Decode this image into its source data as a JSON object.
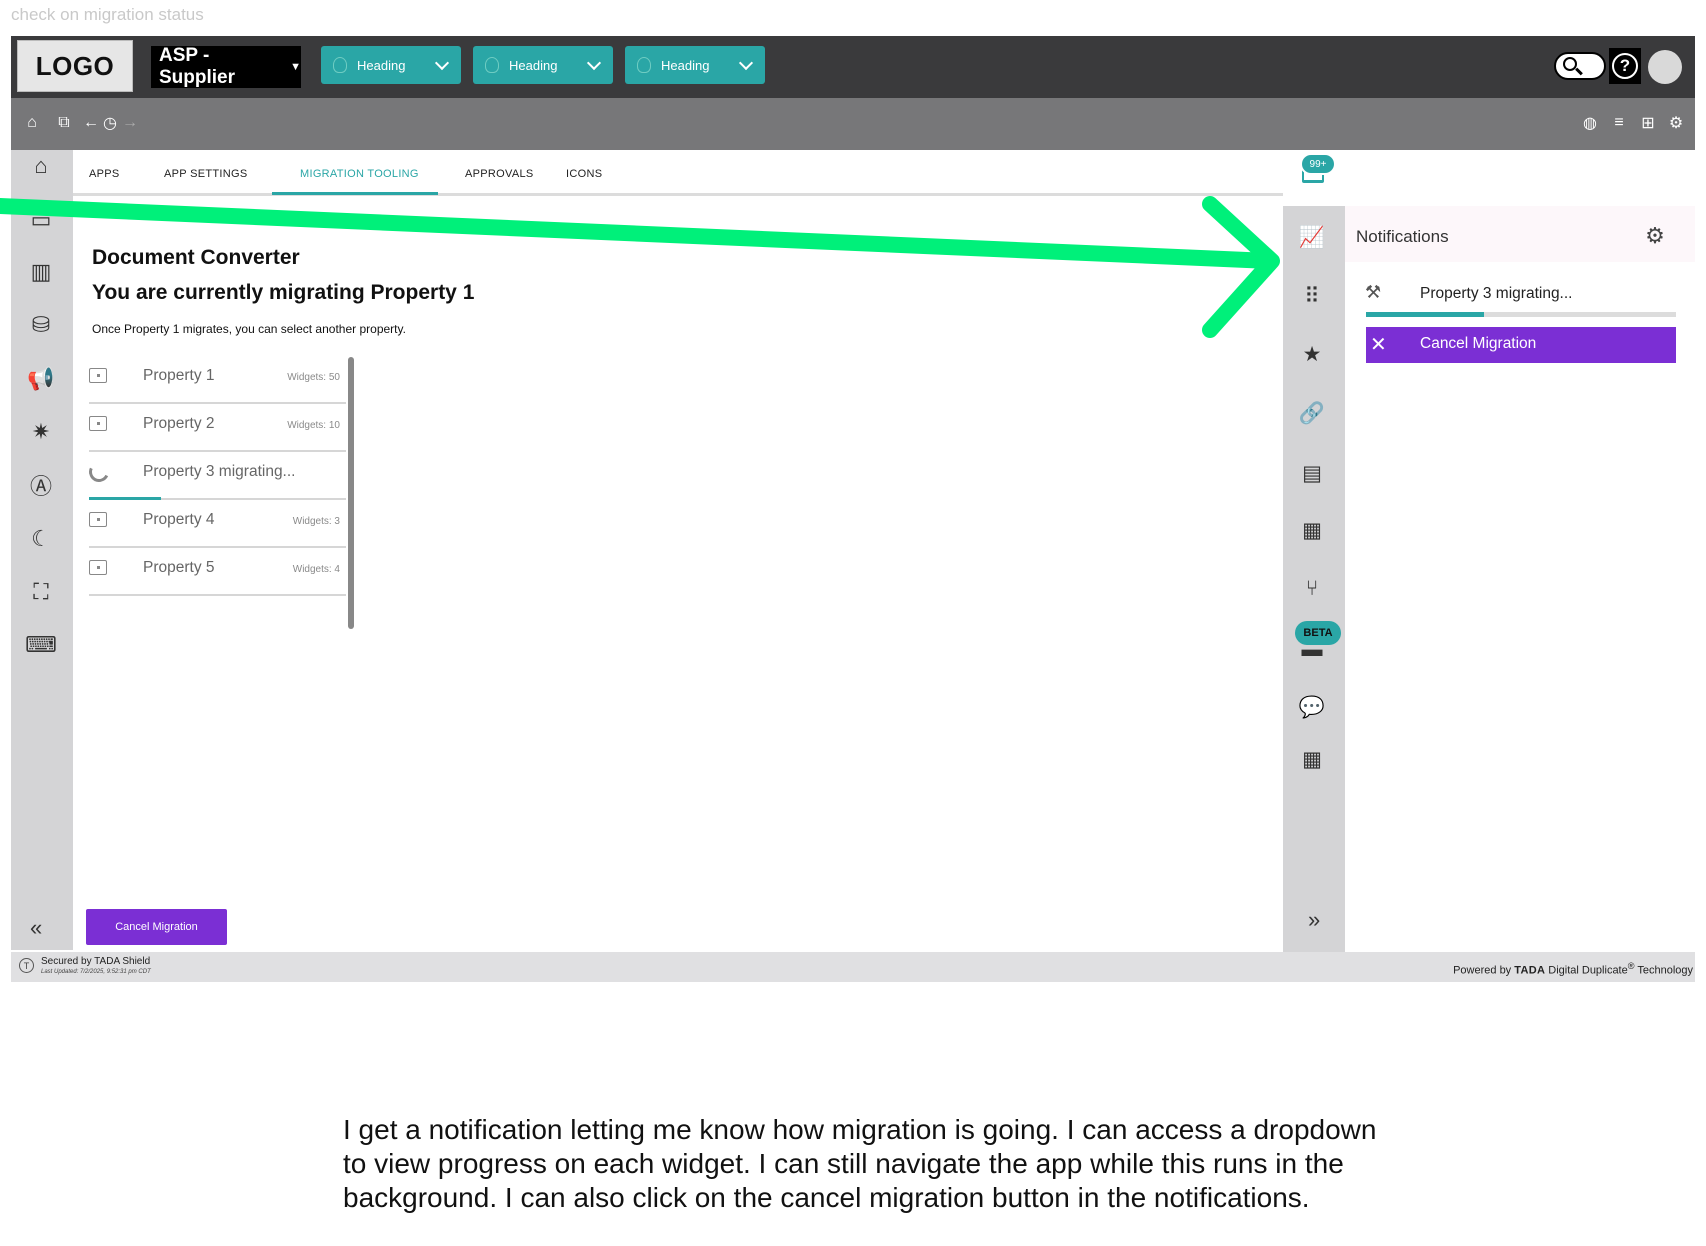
{
  "page_caption": "check on migration status",
  "header": {
    "logo": "LOGO",
    "org_selector": "ASP - Supplier",
    "heading_dropdowns": [
      "Heading",
      "Heading",
      "Heading"
    ],
    "help": "?"
  },
  "tabs": [
    "APPS",
    "APP SETTINGS",
    "MIGRATION TOOLING",
    "APPROVALS",
    "ICONS"
  ],
  "active_tab": "MIGRATION TOOLING",
  "main": {
    "title": "Document Converter",
    "subtitle": "You are currently migrating Property 1",
    "description": "Once Property 1 migrates, you can select another property.",
    "properties": [
      {
        "name": "Property 1",
        "widgets": "Widgets: 50"
      },
      {
        "name": "Property 2",
        "widgets": "Widgets: 10"
      },
      {
        "name": "Property 3 migrating...",
        "widgets": "",
        "progress": 0.28
      },
      {
        "name": "Property 4",
        "widgets": "Widgets: 3"
      },
      {
        "name": "Property 5",
        "widgets": "Widgets: 4"
      }
    ],
    "cancel_button": "Cancel Migration"
  },
  "right_rail": {
    "notification_badge": "99+",
    "beta_badge": "BETA"
  },
  "notifications": {
    "title": "Notifications",
    "item": "Property 3 migrating...",
    "progress": 0.38,
    "cancel_button": "Cancel Migration"
  },
  "footer": {
    "secured": "Secured by TADA Shield",
    "last_updated": "Last Updated: 7/2/2025, 9:52:31 pm CDT",
    "powered_prefix": "Powered by",
    "powered_brand": "TADA",
    "powered_suffix": "Digital Duplicate",
    "powered_reg": "®",
    "powered_end": "Technology"
  },
  "caption": "I get a notification letting me know how migration is going. I can access a dropdown to view progress on each widget. I can still navigate the app while this runs in the background. I can also click on the cancel migration button in the notifications.",
  "colors": {
    "accent": "#2aa6a6",
    "purple": "#7b2fd4",
    "annotation_arrow": "#00f07a"
  }
}
